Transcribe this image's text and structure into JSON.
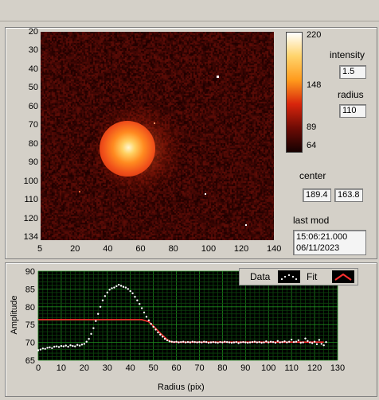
{
  "image_plot": {
    "x_ticks": [
      "5",
      "20",
      "40",
      "60",
      "80",
      "100",
      "120",
      "140"
    ],
    "y_ticks": [
      "20",
      "30",
      "40",
      "50",
      "60",
      "70",
      "80",
      "90",
      "100",
      "110",
      "120",
      "134"
    ]
  },
  "colorbar": {
    "labels": [
      "220",
      "148",
      "89",
      "64"
    ],
    "colors": [
      "#ffffff",
      "#ffd36a",
      "#ff9a1c",
      "#d8250c",
      "#6e0b05",
      "#150101"
    ]
  },
  "controls": {
    "intensity_label": "intensity",
    "intensity_value": "1.5",
    "radius_label": "radius",
    "radius_value": "110",
    "center_label": "center",
    "center_x": "189.4",
    "center_y": "163.8",
    "last_mod_label": "last mod",
    "last_mod_time": "15:06:21.000",
    "last_mod_date": "06/11/2023"
  },
  "legend": {
    "data_label": "Data",
    "fit_label": "Fit"
  },
  "chart_data": {
    "type": "scatter",
    "xlabel": "Radius (pix)",
    "ylabel": "Amplitude",
    "xlim": [
      0,
      130
    ],
    "ylim": [
      65,
      90
    ],
    "x_ticks": [
      "0",
      "10",
      "20",
      "30",
      "40",
      "50",
      "60",
      "70",
      "80",
      "90",
      "100",
      "110",
      "120",
      "130"
    ],
    "y_ticks": [
      "90",
      "85",
      "80",
      "75",
      "70",
      "65"
    ],
    "series": [
      {
        "name": "Data",
        "color": "#ffffff",
        "points": [
          [
            0,
            67.8
          ],
          [
            1,
            68.0
          ],
          [
            2,
            68.3
          ],
          [
            3,
            68.2
          ],
          [
            4,
            68.5
          ],
          [
            5,
            68.6
          ],
          [
            6,
            68.4
          ],
          [
            7,
            68.8
          ],
          [
            8,
            68.9
          ],
          [
            9,
            68.7
          ],
          [
            10,
            69.0
          ],
          [
            11,
            68.9
          ],
          [
            12,
            69.1
          ],
          [
            13,
            68.8
          ],
          [
            14,
            69.2
          ],
          [
            15,
            69.0
          ],
          [
            16,
            68.9
          ],
          [
            17,
            69.3
          ],
          [
            18,
            69.1
          ],
          [
            19,
            69.4
          ],
          [
            20,
            69.6
          ],
          [
            21,
            70.2
          ],
          [
            22,
            71.0
          ],
          [
            23,
            72.4
          ],
          [
            24,
            74.0
          ],
          [
            25,
            76.0
          ],
          [
            26,
            78.0
          ],
          [
            27,
            80.0
          ],
          [
            28,
            81.8
          ],
          [
            29,
            83.0
          ],
          [
            30,
            84.0
          ],
          [
            31,
            84.8
          ],
          [
            32,
            85.2
          ],
          [
            33,
            85.4
          ],
          [
            34,
            85.8
          ],
          [
            35,
            86.2
          ],
          [
            36,
            85.9
          ],
          [
            37,
            85.6
          ],
          [
            38,
            85.4
          ],
          [
            39,
            85.0
          ],
          [
            40,
            84.4
          ],
          [
            41,
            83.8
          ],
          [
            42,
            82.8
          ],
          [
            43,
            81.8
          ],
          [
            44,
            80.8
          ],
          [
            45,
            79.6
          ],
          [
            46,
            78.4
          ],
          [
            47,
            77.2
          ],
          [
            48,
            76.2
          ],
          [
            49,
            75.2
          ],
          [
            50,
            74.4
          ],
          [
            51,
            73.6
          ],
          [
            52,
            72.8
          ],
          [
            53,
            72.2
          ],
          [
            54,
            71.6
          ],
          [
            55,
            71.0
          ],
          [
            56,
            70.6
          ],
          [
            57,
            70.3
          ],
          [
            58,
            70.2
          ],
          [
            59,
            70.1
          ],
          [
            60,
            70.2
          ],
          [
            61,
            70.0
          ],
          [
            62,
            70.1
          ],
          [
            63,
            70.2
          ],
          [
            64,
            70.0
          ],
          [
            65,
            70.1
          ],
          [
            66,
            70.0
          ],
          [
            67,
            70.2
          ],
          [
            68,
            70.1
          ],
          [
            69,
            70.0
          ],
          [
            70,
            70.1
          ],
          [
            71,
            70.0
          ],
          [
            72,
            70.2
          ],
          [
            73,
            70.1
          ],
          [
            74,
            69.9
          ],
          [
            75,
            70.0
          ],
          [
            76,
            70.1
          ],
          [
            77,
            70.0
          ],
          [
            78,
            69.9
          ],
          [
            79,
            70.1
          ],
          [
            80,
            70.0
          ],
          [
            81,
            70.2
          ],
          [
            82,
            70.1
          ],
          [
            83,
            70.0
          ],
          [
            84,
            69.9
          ],
          [
            85,
            70.0
          ],
          [
            86,
            70.1
          ],
          [
            87,
            69.8
          ],
          [
            88,
            70.0
          ],
          [
            89,
            70.1
          ],
          [
            90,
            70.0
          ],
          [
            91,
            69.9
          ],
          [
            92,
            70.0
          ],
          [
            93,
            70.1
          ],
          [
            94,
            70.2
          ],
          [
            95,
            70.0
          ],
          [
            96,
            70.1
          ],
          [
            97,
            69.9
          ],
          [
            98,
            70.0
          ],
          [
            99,
            70.3
          ],
          [
            100,
            70.0
          ],
          [
            101,
            70.2
          ],
          [
            102,
            70.1
          ],
          [
            103,
            69.9
          ],
          [
            104,
            70.4
          ],
          [
            105,
            70.0
          ],
          [
            106,
            70.1
          ],
          [
            107,
            70.3
          ],
          [
            108,
            70.0
          ],
          [
            109,
            70.2
          ],
          [
            110,
            70.8
          ],
          [
            111,
            70.1
          ],
          [
            112,
            70.2
          ],
          [
            113,
            70.6
          ],
          [
            114,
            69.9
          ],
          [
            115,
            70.0
          ],
          [
            116,
            71.1
          ],
          [
            117,
            70.4
          ],
          [
            118,
            70.0
          ],
          [
            119,
            69.8
          ],
          [
            120,
            70.2
          ],
          [
            121,
            69.5
          ],
          [
            122,
            70.7
          ],
          [
            123,
            69.6
          ],
          [
            124,
            69.2
          ],
          [
            125,
            70.1
          ]
        ]
      },
      {
        "name": "Fit",
        "color": "#ff3030",
        "points": [
          [
            0,
            76.4
          ],
          [
            45,
            76.4
          ],
          [
            48,
            75.8
          ],
          [
            50,
            74.6
          ],
          [
            53,
            72.6
          ],
          [
            56,
            70.8
          ],
          [
            58,
            70.1
          ],
          [
            124,
            70.1
          ]
        ]
      }
    ]
  }
}
